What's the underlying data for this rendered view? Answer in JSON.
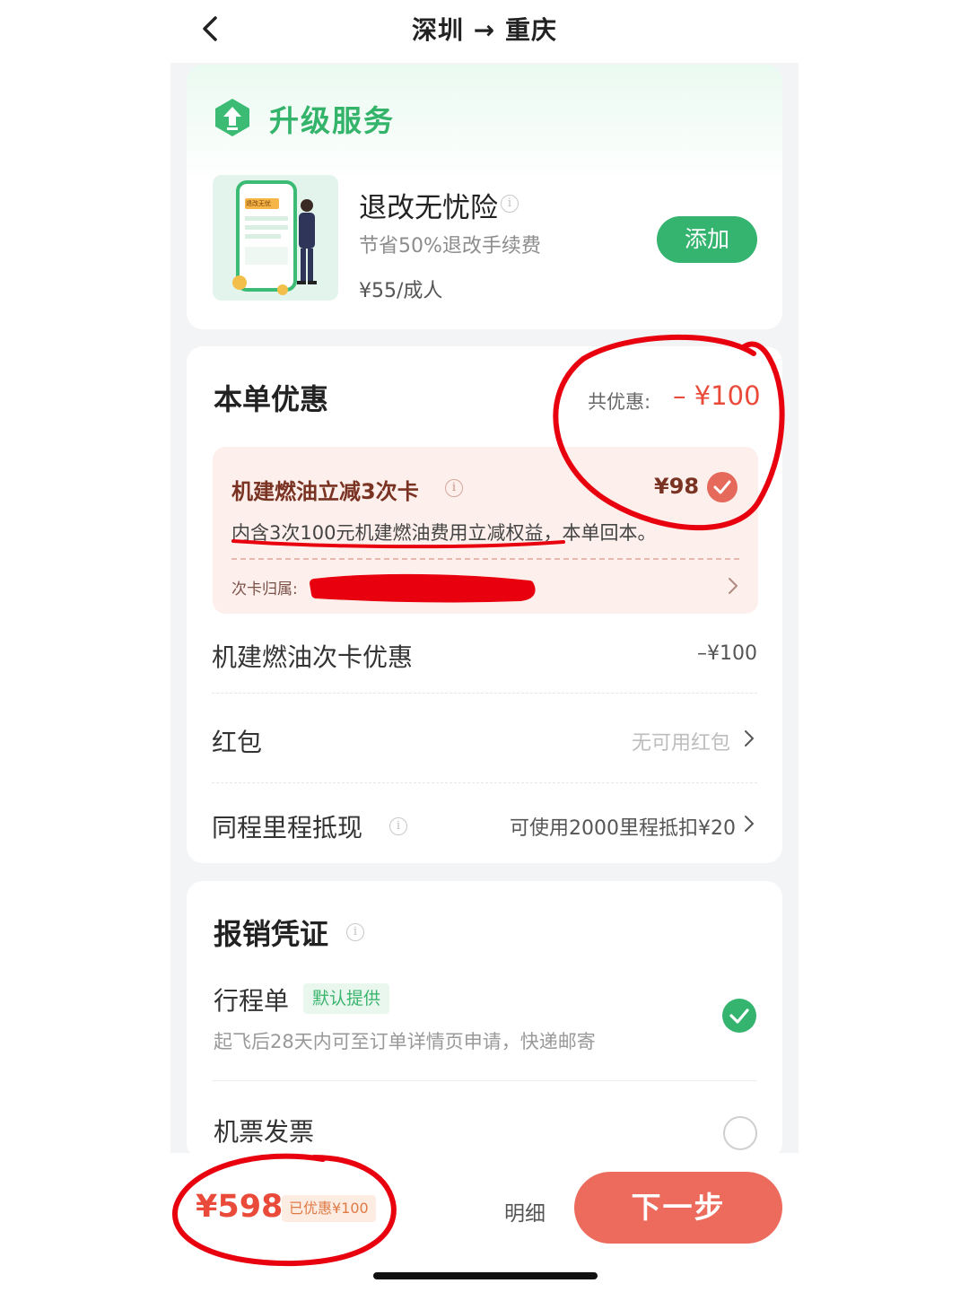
{
  "header": {
    "title": "深圳 → 重庆",
    "back_icon": "chevron-left-icon"
  },
  "upgrade": {
    "title": "升级服务",
    "insurance": {
      "name": "退改无忧险",
      "description": "节省50%退改手续费",
      "price": "¥55/成人",
      "add_label": "添加",
      "illustration_label": "退改无忧"
    }
  },
  "discount": {
    "title": "本单优惠",
    "total_label": "共优惠:",
    "total_value": "– ¥100",
    "fuel_card": {
      "name": "机建燃油立减3次卡",
      "price": "¥98",
      "description": "内含3次100元机建燃油费用立减权益，本单回本。",
      "owner_label": "次卡归属:",
      "selected": true
    },
    "rows": [
      {
        "label": "机建燃油次卡优惠",
        "value": "–¥100"
      },
      {
        "label": "红包",
        "value": "无可用红包"
      },
      {
        "label": "同程里程抵现",
        "value": "可使用2000里程抵扣¥20"
      }
    ]
  },
  "receipt": {
    "title": "报销凭证",
    "itinerary": {
      "label": "行程单",
      "badge": "默认提供",
      "description": "起飞后28天内可至订单详情页申请，快递邮寄",
      "selected": true
    },
    "invoice": {
      "label": "机票发票",
      "selected": false
    }
  },
  "bottom": {
    "total_price": "¥598",
    "saved_badge": "已优惠¥100",
    "detail_label": "明细",
    "next_label": "下一步"
  },
  "colors": {
    "brand_green": "#35b470",
    "price_red": "#ea4a3a",
    "button_red": "#ec6b5c",
    "annotation_red": "#e8000f"
  }
}
